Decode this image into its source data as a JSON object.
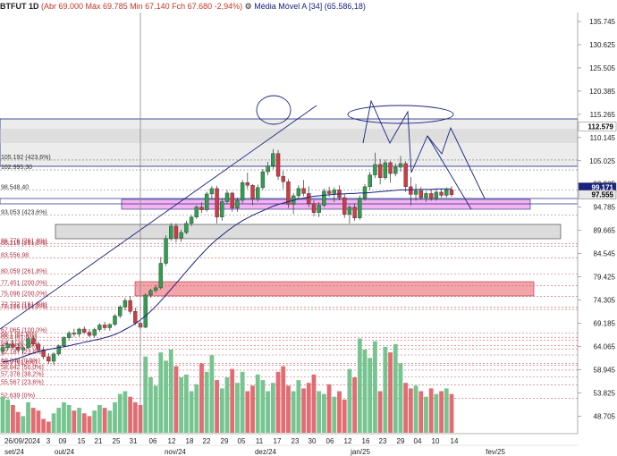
{
  "header": {
    "symbol": "BTFUT 1D",
    "ohlc": "(Abr 69.000 Máx 69.785 Min 67.140 Fch 67.680 -2,94%)",
    "indicator": "Média Móvel A [34] (65.586,18)"
  },
  "colors": {
    "up": "#6fc28a",
    "down": "#e0646a",
    "ma": "#1a237e",
    "band_magenta": "#f2a6ee",
    "band_red": "#f19aa0",
    "band_gray": "#dcdcdc"
  },
  "y_axis": {
    "min": 46000,
    "max": 137000,
    "ticks": [
      "135.745",
      "130.625",
      "125.505",
      "120.385",
      "115.265",
      "110.145",
      "105.025",
      "99.905",
      "94.785",
      "89.665",
      "84.545",
      "79.425",
      "74.305",
      "69.185",
      "64.065",
      "58.945",
      "53.825",
      "48.705"
    ],
    "tick_values": [
      135745,
      130625,
      125505,
      120385,
      115265,
      110145,
      105025,
      99905,
      94785,
      89665,
      84545,
      79425,
      74305,
      69185,
      64065,
      58945,
      53825,
      48705
    ],
    "badges": [
      {
        "label": "112.579",
        "value": 112579,
        "bg": "#ffffff",
        "fg": "#000000"
      },
      {
        "label": "99.171",
        "value": 99171,
        "bg": "#1a237e",
        "fg": "#ffffff"
      },
      {
        "label": "97.555",
        "value": 97555,
        "bg": "#e8e8e8",
        "fg": "#000000"
      }
    ]
  },
  "x_axis": {
    "day_labels": [
      "26/09/2024",
      "3",
      "09",
      "15",
      "21",
      "25",
      "31",
      "06",
      "12",
      "18",
      "22",
      "29",
      "05",
      "11",
      "17",
      "23",
      "30",
      "06",
      "12",
      "16",
      "23",
      "29",
      "04",
      "10",
      "14"
    ],
    "month_labels": [
      "set/24",
      "out/24",
      "nov/24",
      "dez/24",
      "jan/25",
      "fev/25"
    ]
  },
  "fib_labels": [
    {
      "text": "105.192 (423,6%)",
      "value": 105192
    },
    {
      "text": "102.995,30",
      "value": 102995
    },
    {
      "text": "98.548,40",
      "value": 98548
    },
    {
      "text": "93.053 (423,6%)",
      "value": 93053
    },
    {
      "text": "86.776 (261,8%)",
      "value": 86776
    },
    {
      "text": "86.216 (261,8%)",
      "value": 86216
    },
    {
      "text": "83.556,98",
      "value": 83557
    },
    {
      "text": "80.059 (261,8%)",
      "value": 80059
    },
    {
      "text": "77.451 (200,0%)",
      "value": 77451
    },
    {
      "text": "75.096 (200,0%)",
      "value": 75096
    },
    {
      "text": "72.722 (161,8%)",
      "value": 72722
    },
    {
      "text": "72.226 (161,8%)",
      "value": 72226
    },
    {
      "text": "67.065 (100,0%)",
      "value": 67065
    },
    {
      "text": "66.1 (61,8%)",
      "value": 66100
    },
    {
      "text": "65.4 (61,8%)",
      "value": 65400
    },
    {
      "text": "64.3 (38,2%)",
      "value": 64300
    },
    {
      "text": "63.5 (38,2%)",
      "value": 63500
    },
    {
      "text": "62.187 (23,6%)",
      "value": 62187
    },
    {
      "text": "60.348 (0,0%)",
      "value": 60348
    },
    {
      "text": "59.9 (61,8%)",
      "value": 59900
    },
    {
      "text": "58.842 (50,0%)",
      "value": 58842
    },
    {
      "text": "57.378 (38,2%)",
      "value": 57378
    },
    {
      "text": "55.567 (23,6%)",
      "value": 55567
    },
    {
      "text": "52.639 (0%)",
      "value": 52639
    }
  ],
  "chart_data": {
    "type": "candlestick",
    "candles": [
      {
        "o": 63000,
        "h": 64500,
        "l": 62000,
        "c": 63800
      },
      {
        "o": 63800,
        "h": 65200,
        "l": 63200,
        "c": 64600
      },
      {
        "o": 64600,
        "h": 65500,
        "l": 63400,
        "c": 63900
      },
      {
        "o": 63900,
        "h": 64800,
        "l": 62800,
        "c": 63300
      },
      {
        "o": 63300,
        "h": 64200,
        "l": 62500,
        "c": 63800
      },
      {
        "o": 63800,
        "h": 66200,
        "l": 63500,
        "c": 65800
      },
      {
        "o": 65800,
        "h": 66500,
        "l": 64200,
        "c": 64600
      },
      {
        "o": 64600,
        "h": 65200,
        "l": 62800,
        "c": 63300
      },
      {
        "o": 63300,
        "h": 64000,
        "l": 61200,
        "c": 61800
      },
      {
        "o": 61800,
        "h": 62600,
        "l": 60200,
        "c": 60800
      },
      {
        "o": 60800,
        "h": 62800,
        "l": 60000,
        "c": 62400
      },
      {
        "o": 62400,
        "h": 64500,
        "l": 62000,
        "c": 64200
      },
      {
        "o": 64200,
        "h": 66300,
        "l": 63800,
        "c": 66000
      },
      {
        "o": 66000,
        "h": 67500,
        "l": 65500,
        "c": 67000
      },
      {
        "o": 67000,
        "h": 68000,
        "l": 66200,
        "c": 66800
      },
      {
        "o": 66800,
        "h": 68200,
        "l": 66200,
        "c": 67900
      },
      {
        "o": 67900,
        "h": 68500,
        "l": 66800,
        "c": 67200
      },
      {
        "o": 67200,
        "h": 67900,
        "l": 66100,
        "c": 66500
      },
      {
        "o": 66500,
        "h": 68200,
        "l": 66000,
        "c": 67800
      },
      {
        "o": 67800,
        "h": 69200,
        "l": 67300,
        "c": 68800
      },
      {
        "o": 68800,
        "h": 69500,
        "l": 67600,
        "c": 68200
      },
      {
        "o": 68200,
        "h": 69200,
        "l": 67500,
        "c": 68900
      },
      {
        "o": 68900,
        "h": 71200,
        "l": 68600,
        "c": 70800
      },
      {
        "o": 70800,
        "h": 73200,
        "l": 70300,
        "c": 72800
      },
      {
        "o": 72800,
        "h": 74800,
        "l": 72000,
        "c": 74200
      },
      {
        "o": 74200,
        "h": 75200,
        "l": 71200,
        "c": 71800
      },
      {
        "o": 71800,
        "h": 72600,
        "l": 68800,
        "c": 69200
      },
      {
        "o": 69200,
        "h": 69900,
        "l": 67400,
        "c": 68300
      },
      {
        "o": 68300,
        "h": 75800,
        "l": 68100,
        "c": 75400
      },
      {
        "o": 75400,
        "h": 76800,
        "l": 74800,
        "c": 76400
      },
      {
        "o": 76400,
        "h": 77600,
        "l": 75900,
        "c": 77000
      },
      {
        "o": 77000,
        "h": 83800,
        "l": 76600,
        "c": 82400
      },
      {
        "o": 82400,
        "h": 88600,
        "l": 81800,
        "c": 87900
      },
      {
        "o": 87900,
        "h": 91300,
        "l": 87400,
        "c": 90600
      },
      {
        "o": 90600,
        "h": 91200,
        "l": 87000,
        "c": 88000
      },
      {
        "o": 88000,
        "h": 89800,
        "l": 87100,
        "c": 89200
      },
      {
        "o": 89200,
        "h": 91800,
        "l": 88800,
        "c": 91200
      },
      {
        "o": 91200,
        "h": 93100,
        "l": 90600,
        "c": 92600
      },
      {
        "o": 92600,
        "h": 95200,
        "l": 92200,
        "c": 94800
      },
      {
        "o": 94800,
        "h": 95800,
        "l": 93500,
        "c": 94200
      },
      {
        "o": 94200,
        "h": 98200,
        "l": 93800,
        "c": 97700
      },
      {
        "o": 97700,
        "h": 99400,
        "l": 96500,
        "c": 98900
      },
      {
        "o": 98900,
        "h": 99500,
        "l": 91200,
        "c": 92600
      },
      {
        "o": 92600,
        "h": 96600,
        "l": 91800,
        "c": 96000
      },
      {
        "o": 96000,
        "h": 98600,
        "l": 95400,
        "c": 97900
      },
      {
        "o": 97900,
        "h": 98200,
        "l": 93800,
        "c": 94600
      },
      {
        "o": 94600,
        "h": 96900,
        "l": 93800,
        "c": 96300
      },
      {
        "o": 96300,
        "h": 100800,
        "l": 95700,
        "c": 100200
      },
      {
        "o": 100200,
        "h": 102400,
        "l": 98800,
        "c": 99600
      },
      {
        "o": 99600,
        "h": 99900,
        "l": 95200,
        "c": 96600
      },
      {
        "o": 96600,
        "h": 99800,
        "l": 96000,
        "c": 99100
      },
      {
        "o": 99100,
        "h": 103200,
        "l": 98600,
        "c": 102600
      },
      {
        "o": 102600,
        "h": 104800,
        "l": 101800,
        "c": 103900
      },
      {
        "o": 103900,
        "h": 107600,
        "l": 103200,
        "c": 106600
      },
      {
        "o": 106600,
        "h": 107400,
        "l": 100800,
        "c": 101600
      },
      {
        "o": 101600,
        "h": 102800,
        "l": 98800,
        "c": 100400
      },
      {
        "o": 100400,
        "h": 101000,
        "l": 94600,
        "c": 95400
      },
      {
        "o": 95400,
        "h": 97900,
        "l": 93300,
        "c": 97300
      },
      {
        "o": 97300,
        "h": 99600,
        "l": 96800,
        "c": 98900
      },
      {
        "o": 98900,
        "h": 100800,
        "l": 97200,
        "c": 97800
      },
      {
        "o": 97800,
        "h": 99400,
        "l": 94800,
        "c": 95600
      },
      {
        "o": 95600,
        "h": 96300,
        "l": 92800,
        "c": 93600
      },
      {
        "o": 93600,
        "h": 95900,
        "l": 92600,
        "c": 95200
      },
      {
        "o": 95200,
        "h": 98900,
        "l": 94800,
        "c": 98300
      },
      {
        "o": 98300,
        "h": 99300,
        "l": 97100,
        "c": 97800
      },
      {
        "o": 97800,
        "h": 99200,
        "l": 95900,
        "c": 98600
      },
      {
        "o": 98600,
        "h": 99600,
        "l": 96300,
        "c": 96900
      },
      {
        "o": 96900,
        "h": 97600,
        "l": 92400,
        "c": 93200
      },
      {
        "o": 93200,
        "h": 95200,
        "l": 91200,
        "c": 94800
      },
      {
        "o": 94800,
        "h": 95600,
        "l": 91800,
        "c": 92400
      },
      {
        "o": 92400,
        "h": 97400,
        "l": 92000,
        "c": 96800
      },
      {
        "o": 96800,
        "h": 99900,
        "l": 96200,
        "c": 99300
      },
      {
        "o": 99300,
        "h": 102600,
        "l": 98600,
        "c": 101900
      },
      {
        "o": 101900,
        "h": 106800,
        "l": 101200,
        "c": 104200
      },
      {
        "o": 104200,
        "h": 105400,
        "l": 99800,
        "c": 101300
      },
      {
        "o": 101300,
        "h": 105300,
        "l": 100800,
        "c": 104600
      },
      {
        "o": 104600,
        "h": 105000,
        "l": 100200,
        "c": 102200
      },
      {
        "o": 102200,
        "h": 104400,
        "l": 101600,
        "c": 103600
      },
      {
        "o": 103600,
        "h": 106100,
        "l": 102600,
        "c": 104400
      },
      {
        "o": 104400,
        "h": 104900,
        "l": 98200,
        "c": 99300
      },
      {
        "o": 99300,
        "h": 101400,
        "l": 95200,
        "c": 97600
      },
      {
        "o": 97600,
        "h": 99900,
        "l": 96200,
        "c": 98400
      },
      {
        "o": 98400,
        "h": 99200,
        "l": 96400,
        "c": 96900
      },
      {
        "o": 96900,
        "h": 98300,
        "l": 95900,
        "c": 97800
      },
      {
        "o": 97800,
        "h": 98600,
        "l": 96200,
        "c": 96700
      },
      {
        "o": 96700,
        "h": 98700,
        "l": 96200,
        "c": 98100
      },
      {
        "o": 98100,
        "h": 98900,
        "l": 96900,
        "c": 97400
      },
      {
        "o": 97400,
        "h": 99100,
        "l": 96900,
        "c": 98600
      },
      {
        "o": 98600,
        "h": 99400,
        "l": 97100,
        "c": 97555
      }
    ],
    "volume": [
      26,
      24,
      20,
      15,
      12,
      22,
      18,
      16,
      10,
      8,
      14,
      18,
      22,
      20,
      16,
      18,
      14,
      12,
      16,
      20,
      18,
      16,
      22,
      28,
      30,
      26,
      22,
      20,
      55,
      40,
      34,
      58,
      52,
      60,
      48,
      40,
      42,
      30,
      35,
      50,
      44,
      56,
      38,
      32,
      40,
      46,
      36,
      44,
      30,
      34,
      42,
      38,
      30,
      36,
      44,
      48,
      34,
      30,
      38,
      32,
      36,
      42,
      30,
      28,
      35,
      26,
      30,
      24,
      46,
      40,
      68,
      60,
      54,
      66,
      30,
      62,
      58,
      64,
      50,
      36,
      32,
      34,
      30,
      26,
      32,
      28,
      30,
      32,
      28
    ],
    "moving_average": [
      60600,
      60800,
      61100,
      61400,
      61800,
      62200,
      62600,
      62900,
      63200,
      63400,
      63600,
      63800,
      64000,
      64200,
      64500,
      64700,
      65000,
      65200,
      65500,
      65700,
      66000,
      66300,
      66700,
      67200,
      67800,
      68400,
      69100,
      69900,
      70800,
      71800,
      72900,
      74100,
      75400,
      76700,
      78000,
      79300,
      80600,
      81900,
      83200,
      84400,
      85600,
      86700,
      87700,
      88600,
      89500,
      90300,
      91100,
      91800,
      92400,
      93000,
      93500,
      94000,
      94500,
      95000,
      95400,
      95700,
      96000,
      96300,
      96600,
      96800,
      97000,
      97200,
      97300,
      97400,
      97500,
      97600,
      97700,
      97700,
      97800,
      97800,
      97900,
      97900,
      98000,
      98100,
      98200,
      98300,
      98400,
      98500,
      98600,
      98600,
      98600,
      98700,
      98700,
      98700,
      98700,
      98800,
      98800,
      98800,
      98800
    ]
  }
}
